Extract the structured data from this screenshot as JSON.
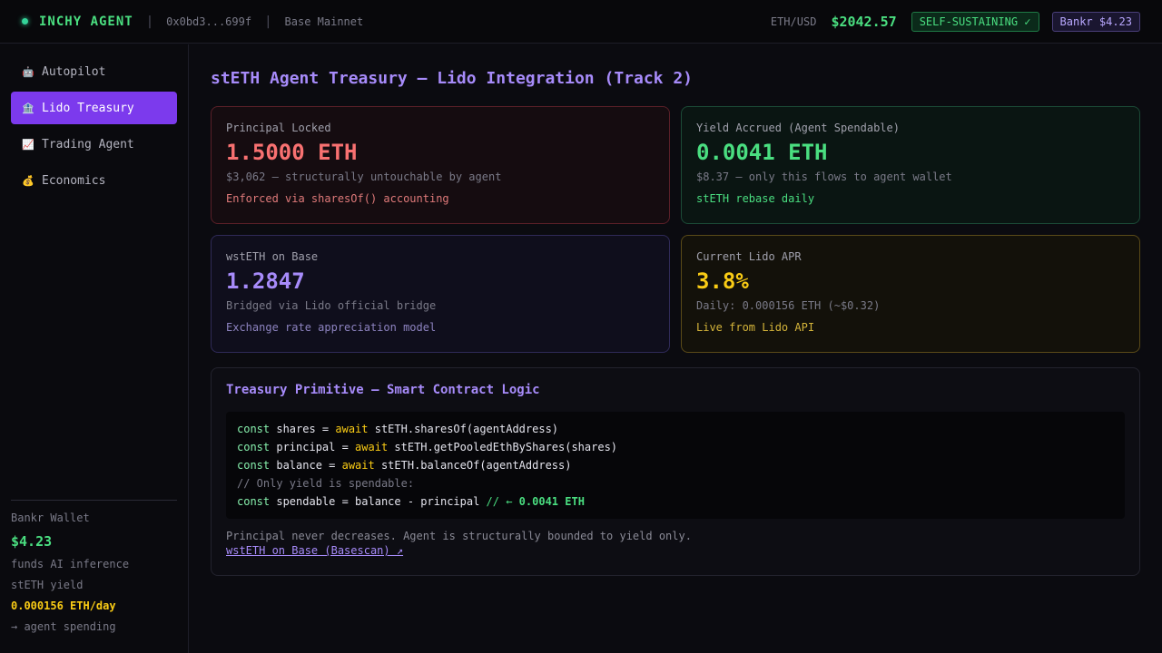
{
  "topbar": {
    "brand": "INCHY AGENT",
    "sep": "|",
    "address": "0x0bd3...699f",
    "network": "Base Mainnet",
    "pair": "ETH/USD",
    "price": "$2042.57",
    "status": "SELF-SUSTAINING ✓",
    "bankr": "Bankr $4.23"
  },
  "sidebar": {
    "items": [
      {
        "icon": "🤖",
        "label": "Autopilot"
      },
      {
        "icon": "🏦",
        "label": "Lido Treasury"
      },
      {
        "icon": "📈",
        "label": "Trading Agent"
      },
      {
        "icon": "💰",
        "label": "Economics"
      }
    ],
    "active_index": 1,
    "wallet": {
      "title": "Bankr Wallet",
      "amount": "$4.23",
      "line1": "funds AI inference",
      "line2": "stETH yield",
      "rate": "0.000156 ETH/day",
      "line3": "→ agent spending"
    }
  },
  "main": {
    "title": "stETH Agent Treasury — Lido Integration (Track 2)",
    "cards": {
      "principal": {
        "label": "Principal Locked",
        "value": "1.5000 ETH",
        "sub": "$3,062 — structurally untouchable by agent",
        "note": "Enforced via sharesOf() accounting"
      },
      "yield": {
        "label": "Yield Accrued (Agent Spendable)",
        "value": "0.0041 ETH",
        "sub": "$8.37 — only this flows to agent wallet",
        "note": "stETH rebase daily"
      },
      "wsteth": {
        "label": "wstETH on Base",
        "value": "1.2847",
        "sub": "Bridged via Lido official bridge",
        "note": "Exchange rate appreciation model"
      },
      "apr": {
        "label": "Current Lido APR",
        "value": "3.8%",
        "sub": "Daily: 0.000156 ETH (~$0.32)",
        "note": "Live from Lido API"
      }
    },
    "logic": {
      "title": "Treasury Primitive — Smart Contract Logic",
      "code": {
        "kw": "const",
        "aw": "await",
        "l1_a": " shares = ",
        "l1_b": " stETH.sharesOf(agentAddress)",
        "l2_a": " principal = ",
        "l2_b": " stETH.getPooledEthByShares(shares)",
        "l3_a": " balance = ",
        "l3_b": " stETH.balanceOf(agentAddress)",
        "l4": "// Only yield is spendable:",
        "l5_a": " spendable = balance - principal ",
        "l5_c": "// ← ",
        "l5_d": "0.0041 ETH"
      },
      "description": "Principal never decreases. Agent is structurally bounded to yield only.",
      "link": "wstETH on Base (Basescan) ↗"
    }
  },
  "colors": {
    "accent": "#7c3aed",
    "green": "#4ade80",
    "red": "#f87171",
    "purple": "#a78bfa",
    "yellow": "#facc15"
  }
}
